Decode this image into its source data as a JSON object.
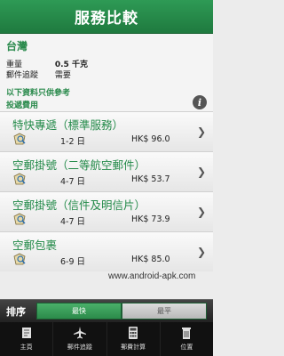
{
  "header": {
    "title": "服務比較"
  },
  "summary": {
    "destination": "台灣",
    "weight_label": "重量",
    "weight_value": "0.5 千克",
    "tracking_label": "郵件追蹤",
    "tracking_value": "需要",
    "note": "以下資料只供參考",
    "fee_heading": "投遞費用"
  },
  "services": [
    {
      "name": "特快專遞（標準服務）",
      "days": "1-2 日",
      "price": "HK$ 96.0"
    },
    {
      "name": "空郵掛號（二等航空郵件）",
      "days": "4-7 日",
      "price": "HK$ 53.7"
    },
    {
      "name": "空郵掛號（信件及明信片）",
      "days": "4-7 日",
      "price": "HK$ 73.9"
    },
    {
      "name": "空郵包裹",
      "days": "6-9 日",
      "price": "HK$ 85.0"
    }
  ],
  "watermark": "www.android-apk.com",
  "sort": {
    "label": "排序",
    "option_fastest": "最快",
    "option_cheapest": "最平",
    "selected": "最快"
  },
  "tabs": [
    {
      "label": "主頁",
      "icon": "home-icon"
    },
    {
      "label": "郵件追蹤",
      "icon": "plane-icon"
    },
    {
      "label": "郵費計算",
      "icon": "calculator-icon"
    },
    {
      "label": "位置",
      "icon": "trash-location-icon"
    }
  ],
  "colors": {
    "accent": "#238a49",
    "title_bar": "#1f7a3f",
    "tab_bar": "#111111"
  }
}
